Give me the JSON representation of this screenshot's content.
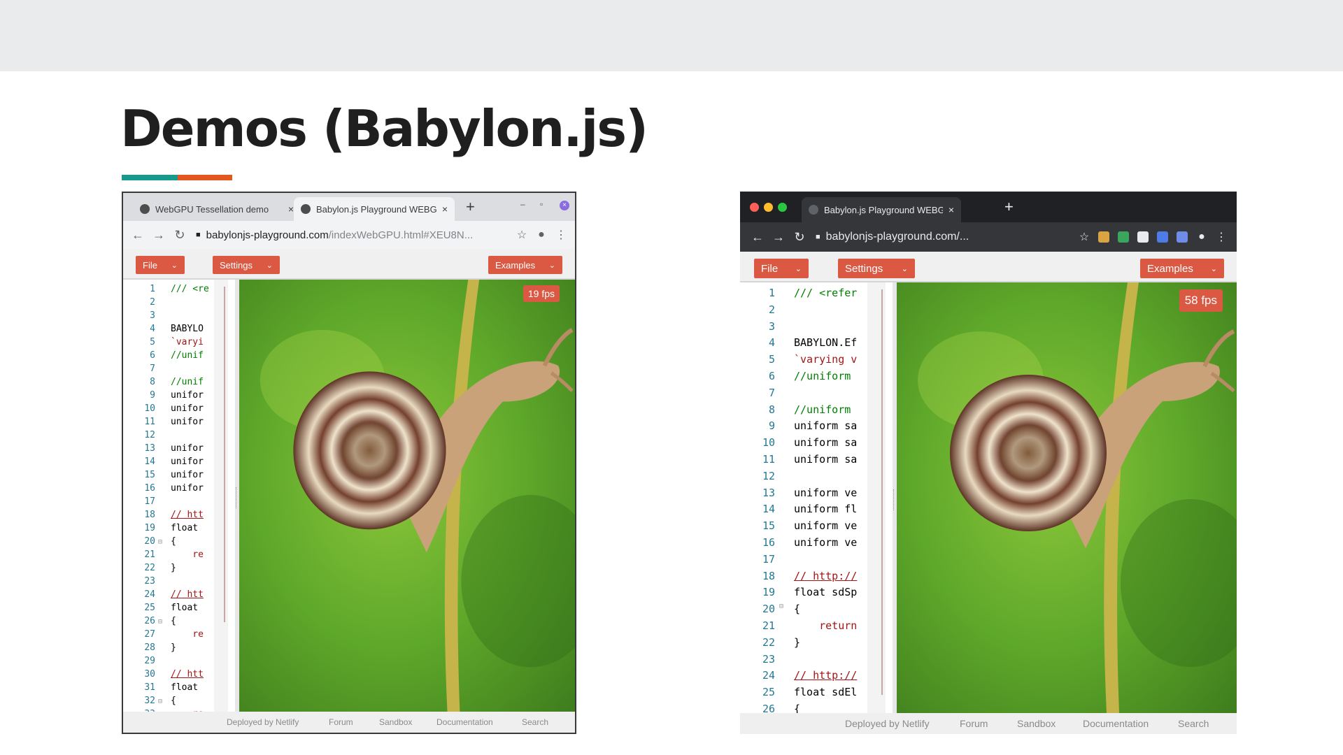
{
  "slide": {
    "title": "Demos (Babylon.js)",
    "accent_colors": [
      "#17998d",
      "#e2571d"
    ]
  },
  "left_browser": {
    "tabs": [
      {
        "label": "WebGPU Tessellation demo",
        "icon": "globe-icon",
        "close": "×"
      },
      {
        "label": "Babylon.js Playground WEBGPU",
        "icon": "globe-icon",
        "close": "×",
        "active": true
      }
    ],
    "new_tab": "+",
    "window_controls": {
      "minimize": "–",
      "restore": "▫",
      "close": "×"
    },
    "url_host": "babylonjs-playground.com",
    "url_path": "/indexWebGPU.html#XEU8N...",
    "nav": {
      "back": "←",
      "forward": "→",
      "reload": "↻"
    },
    "addr_icons": {
      "star": "☆",
      "account": "●",
      "menu": "⋮"
    },
    "toolbar": {
      "file": "File",
      "settings": "Settings",
      "examples": "Examples",
      "chevron": "⌄"
    },
    "fps": "19 fps",
    "line_numbers": [
      "1",
      "2",
      "3",
      "4",
      "5",
      "6",
      "7",
      "8",
      "9",
      "10",
      "11",
      "12",
      "13",
      "14",
      "15",
      "16",
      "17",
      "18",
      "19",
      "20",
      "21",
      "22",
      "23",
      "24",
      "25",
      "26",
      "27",
      "28",
      "29",
      "30",
      "31",
      "32",
      "33"
    ],
    "code_lines": [
      "/// <re",
      "",
      "",
      "BABYLO",
      "`varyi",
      "//unif",
      "",
      "//unif",
      "unifor",
      "unifor",
      "unifor",
      "",
      "unifor",
      "unifor",
      "unifor",
      "unifor",
      "",
      "// htt",
      "float ",
      "{",
      "    re",
      "}",
      "",
      "// htt",
      "float ",
      "{",
      "    re",
      "}",
      "",
      "// htt",
      "float ",
      "{",
      "    re"
    ],
    "footer": [
      "Deployed by Netlify",
      "Forum",
      "Sandbox",
      "Documentation",
      "Search"
    ]
  },
  "right_browser": {
    "tabs": [
      {
        "label": "Babylon.js Playground WEBGPU",
        "icon": "globe-icon",
        "close": "×",
        "active": true
      }
    ],
    "new_tab": "+",
    "url_host": "babylonjs-playground.com/...",
    "nav": {
      "back": "←",
      "forward": "→",
      "reload": "↻"
    },
    "addr_icons": {
      "star": "☆",
      "account": "●",
      "menu": "⋮"
    },
    "extension_colors": [
      "#d9a441",
      "#3aa55d",
      "#e8eaed",
      "#4e7be8",
      "#6f8de8"
    ],
    "toolbar": {
      "file": "File",
      "settings": "Settings",
      "examples": "Examples",
      "chevron": "⌄"
    },
    "fps": "58 fps",
    "line_numbers": [
      "1",
      "2",
      "3",
      "4",
      "5",
      "6",
      "7",
      "8",
      "9",
      "10",
      "11",
      "12",
      "13",
      "14",
      "15",
      "16",
      "17",
      "18",
      "19",
      "20",
      "21",
      "22",
      "23",
      "24",
      "25",
      "26"
    ],
    "code_lines": [
      "/// <refer",
      "",
      "",
      "BABYLON.Ef",
      "`varying v",
      "//uniform ",
      "",
      "//uniform ",
      "uniform sa",
      "uniform sa",
      "uniform sa",
      "",
      "uniform ve",
      "uniform fl",
      "uniform ve",
      "uniform ve",
      "",
      "// http://",
      "float sdSp",
      "{",
      "    return",
      "}",
      "",
      "// http://",
      "float sdEl",
      "{"
    ],
    "footer": [
      "Deployed by Netlify",
      "Forum",
      "Sandbox",
      "Documentation",
      "Search"
    ]
  }
}
